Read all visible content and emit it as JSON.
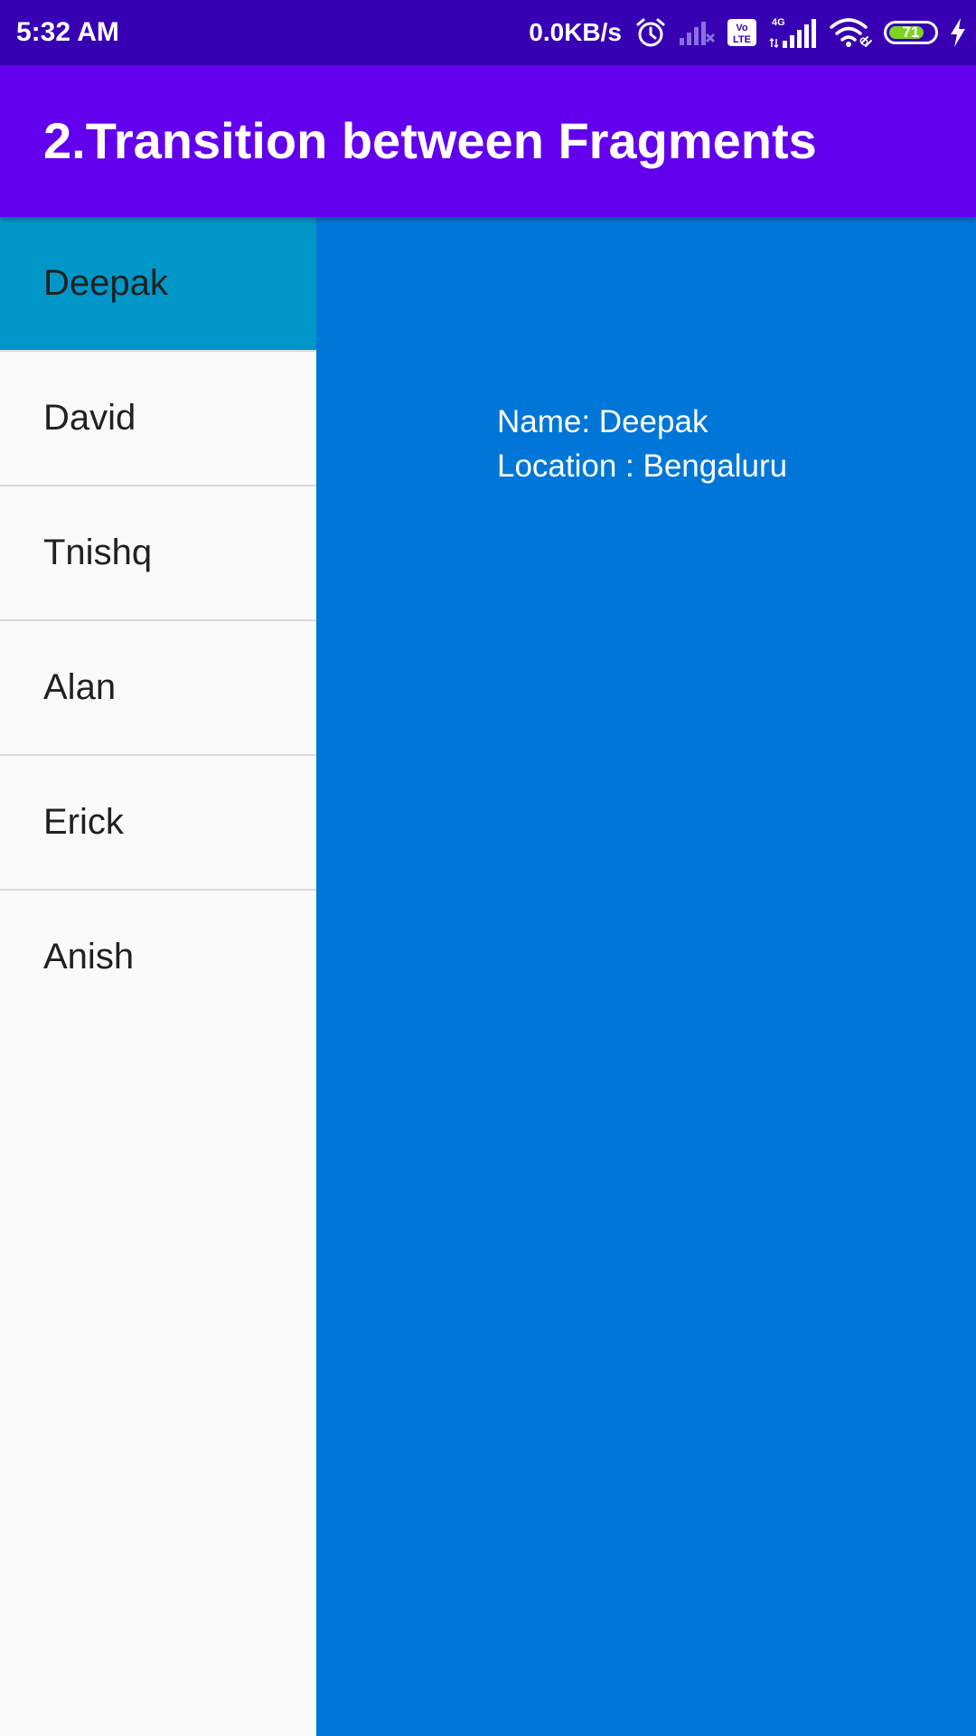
{
  "status_bar": {
    "time": "5:32 AM",
    "network_speed": "0.0KB/s",
    "network_type": "4G",
    "volte_label": "Vo\nLTE",
    "battery_level": "71",
    "icons": [
      "alarm-icon",
      "signal-no-sim-icon",
      "volte-icon",
      "signal-4g-icon",
      "wifi-icon",
      "battery-icon",
      "charging-icon"
    ]
  },
  "app_bar": {
    "title": "2.Transition between Fragments"
  },
  "list": {
    "items": [
      {
        "label": "Deepak"
      },
      {
        "label": "David"
      },
      {
        "label": "Tnishq"
      },
      {
        "label": "Alan"
      },
      {
        "label": "Erick"
      },
      {
        "label": "Anish"
      }
    ],
    "selected_index": 0
  },
  "detail": {
    "name_line": "Name: Deepak",
    "location_line": "Location : Bengaluru"
  },
  "colors": {
    "status_bar": "#3700b3",
    "app_bar": "#6200ee",
    "selected_item": "#0097c8",
    "detail_background": "#0077d8",
    "list_background": "#fafafa",
    "battery_fill": "#7ed321"
  }
}
